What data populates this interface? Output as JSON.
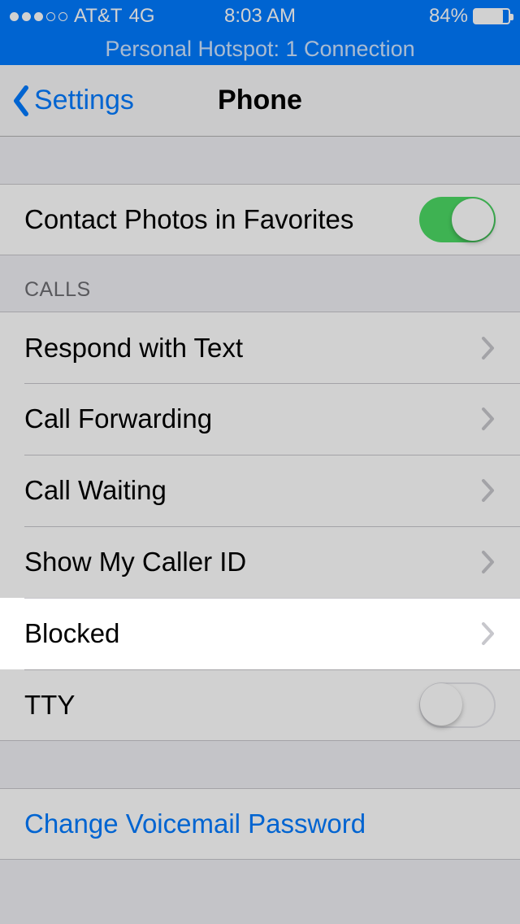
{
  "status": {
    "carrier": "AT&T",
    "network": "4G",
    "time": "8:03 AM",
    "battery_pct": "84%"
  },
  "hotspot": "Personal Hotspot: 1 Connection",
  "nav": {
    "back": "Settings",
    "title": "Phone"
  },
  "favorites_row": {
    "label": "Contact Photos in Favorites",
    "on": true
  },
  "calls_header": "CALLS",
  "calls": {
    "respond": "Respond with Text",
    "forwarding": "Call Forwarding",
    "waiting": "Call Waiting",
    "callerid": "Show My Caller ID",
    "blocked": "Blocked",
    "tty": "TTY"
  },
  "voicemail_link": "Change Voicemail Password",
  "colors": {
    "tint": "#007aff",
    "toggle_on": "#4cd964"
  }
}
